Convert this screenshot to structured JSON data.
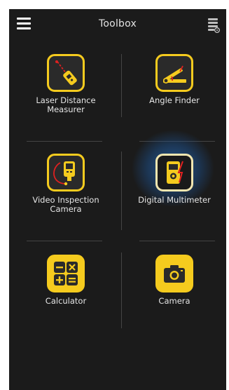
{
  "header": {
    "title": "Toolbox",
    "menu_icon": "hamburger-menu-icon",
    "settings_icon": "settings-list-icon"
  },
  "tools": [
    {
      "label": "Laser Distance Measurer",
      "line1": "Laser Distance",
      "line2": "Measurer",
      "icon": "laser-distance-icon"
    },
    {
      "label": "Angle Finder",
      "line1": "Angle Finder",
      "line2": "",
      "icon": "angle-finder-icon"
    },
    {
      "label": "Video Inspection Camera",
      "line1": "Video Inspection",
      "line2": "Camera",
      "icon": "video-inspection-icon"
    },
    {
      "label": "Digital Multimeter",
      "line1": "Digital Multimeter",
      "line2": "",
      "icon": "multimeter-icon",
      "selected": true
    },
    {
      "label": "Calculator",
      "line1": "Calculator",
      "line2": "",
      "icon": "calculator-icon"
    },
    {
      "label": "Camera",
      "line1": "Camera",
      "line2": "",
      "icon": "camera-icon"
    }
  ],
  "colors": {
    "background": "#1b1b1b",
    "accent": "#f5cb1e",
    "selected_glow": "#2a6db8"
  }
}
